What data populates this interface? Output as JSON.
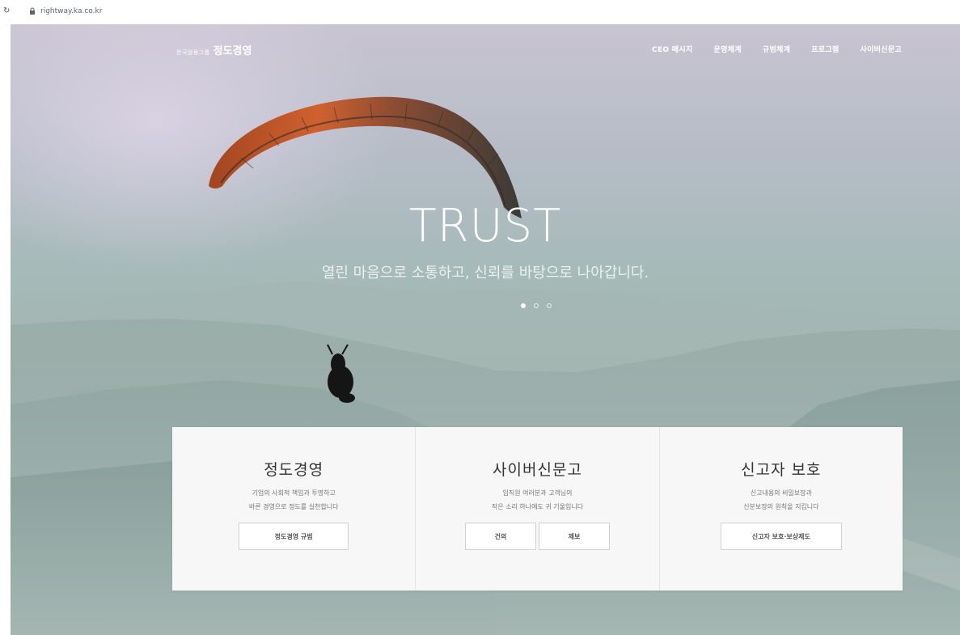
{
  "browser": {
    "url": "rightway.ka.co.kr"
  },
  "header": {
    "logo_small": "한국일용그룹",
    "logo_main": "정도경영",
    "nav": [
      {
        "label": "CEO 메시지"
      },
      {
        "label": "운영체계"
      },
      {
        "label": "규범체계"
      },
      {
        "label": "프로그램"
      },
      {
        "label": "사이버신문고"
      }
    ]
  },
  "hero": {
    "headline": "TRUST",
    "subline": "열린 마음으로 소통하고, 신뢰를 바탕으로 나아갑니다.",
    "slide_count": 3,
    "active_slide": 1
  },
  "cards": [
    {
      "title": "정도경영",
      "desc": [
        "기업의 사회적 책임과 투명하고",
        "바른 경영으로 정도를 실천합니다"
      ],
      "buttons": [
        "정도경영 규범"
      ]
    },
    {
      "title": "사이버신문고",
      "desc": [
        "임직원 여러분과 고객님의",
        "작은 소리 하나에도 귀 기울입니다"
      ],
      "buttons": [
        "건의",
        "제보"
      ]
    },
    {
      "title": "신고자 보호",
      "desc": [
        "신고내용의 비밀보장과",
        "신분보장의 원칙을 지킵니다"
      ],
      "buttons": [
        "신고자 보호·보상제도"
      ]
    }
  ],
  "colors": {
    "sky_top": "#c9c4d2",
    "sky_bottom": "#5f8079",
    "card_bg": "#f6f7f6",
    "canopy_orange": "#c4532a",
    "canopy_dark": "#2b2d2c"
  }
}
